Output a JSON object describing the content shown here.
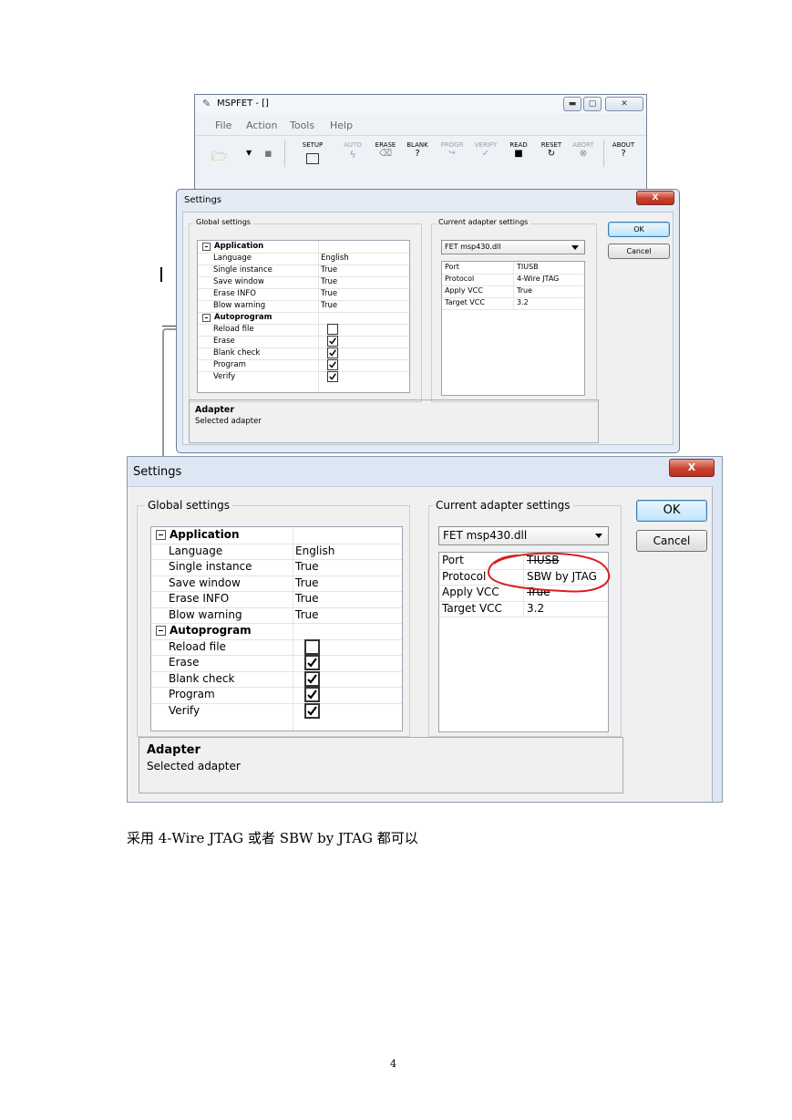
{
  "mspfet_window": {
    "title": "MSPFET - []",
    "menu": [
      "File",
      "Action",
      "Tools",
      "Help"
    ],
    "toolbar": [
      {
        "label": "SETUP",
        "enabled": true,
        "icon": "setup-icon"
      },
      {
        "label": "AUTO",
        "enabled": false,
        "icon": "lightning-icon"
      },
      {
        "label": "ERASE",
        "enabled": true,
        "icon": "eraser-icon"
      },
      {
        "label": "BLANK",
        "enabled": true,
        "icon": "blank-check-icon"
      },
      {
        "label": "PROGR",
        "enabled": false,
        "icon": "program-icon"
      },
      {
        "label": "VERIFY",
        "enabled": false,
        "icon": "verify-icon"
      },
      {
        "label": "READ",
        "enabled": true,
        "icon": "read-icon"
      },
      {
        "label": "RESET",
        "enabled": true,
        "icon": "reset-icon"
      },
      {
        "label": "ABORT",
        "enabled": false,
        "icon": "abort-icon"
      },
      {
        "label": "ABOUT",
        "enabled": true,
        "icon": "about-icon"
      }
    ]
  },
  "dialog1": {
    "title": "Settings",
    "global_settings_label": "Global settings",
    "application_label": "Application",
    "application_items": [
      {
        "name": "Language",
        "value": "English"
      },
      {
        "name": "Single instance",
        "value": "True"
      },
      {
        "name": "Save window",
        "value": "True"
      },
      {
        "name": "Erase INFO",
        "value": "True"
      },
      {
        "name": "Blow warning",
        "value": "True"
      }
    ],
    "autoprogram_label": "Autoprogram",
    "autoprogram_items": [
      {
        "name": "Reload file",
        "checked": false
      },
      {
        "name": "Erase",
        "checked": true
      },
      {
        "name": "Blank check",
        "checked": true
      },
      {
        "name": "Program",
        "checked": true
      },
      {
        "name": "Verify",
        "checked": true
      }
    ],
    "adapter_settings_label": "Current adapter settings",
    "adapter_select": "FET msp430.dll",
    "adapter_items": [
      {
        "name": "Port",
        "value": "TIUSB"
      },
      {
        "name": "Protocol",
        "value": "4-Wire JTAG"
      },
      {
        "name": "Apply VCC",
        "value": "True"
      },
      {
        "name": "Target VCC",
        "value": "3.2"
      }
    ],
    "ok_label": "OK",
    "cancel_label": "Cancel",
    "info_title": "Adapter",
    "info_text": "Selected adapter",
    "close_label": "X"
  },
  "dialog2": {
    "title": "Settings",
    "global_settings_label": "Global settings",
    "application_label": "Application",
    "application_items": [
      {
        "name": "Language",
        "value": "English"
      },
      {
        "name": "Single instance",
        "value": "True"
      },
      {
        "name": "Save window",
        "value": "True"
      },
      {
        "name": "Erase INFO",
        "value": "True"
      },
      {
        "name": "Blow warning",
        "value": "True"
      }
    ],
    "autoprogram_label": "Autoprogram",
    "autoprogram_items": [
      {
        "name": "Reload file",
        "checked": false
      },
      {
        "name": "Erase",
        "checked": true
      },
      {
        "name": "Blank check",
        "checked": true
      },
      {
        "name": "Program",
        "checked": true
      },
      {
        "name": "Verify",
        "checked": true
      }
    ],
    "adapter_settings_label": "Current adapter settings",
    "adapter_select": "FET msp430.dll",
    "adapter_items": [
      {
        "name": "Port",
        "value": "TIUSB"
      },
      {
        "name": "Protocol",
        "value": "SBW by JTAG"
      },
      {
        "name": "Apply VCC",
        "value": "True"
      },
      {
        "name": "Target VCC",
        "value": "3.2"
      }
    ],
    "ok_label": "OK",
    "cancel_label": "Cancel",
    "info_title": "Adapter",
    "info_text": "Selected adapter",
    "close_label": "X"
  },
  "caption": "采用 4-Wire JTAG 或者 SBW by JTAG 都可以",
  "page_number": "4",
  "colors": {
    "annotation_red": "#d81e1e",
    "accent_blue": "#3c7fb1"
  }
}
